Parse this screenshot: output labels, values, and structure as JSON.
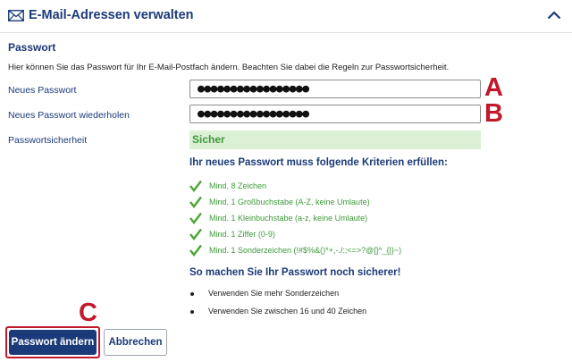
{
  "header": {
    "title": "E-Mail-Adressen verwalten",
    "mail_icon": "envelope-icon",
    "collapse_icon": "chevron-up-icon",
    "accent_color": "#1b3a7a"
  },
  "section": {
    "title": "Passwort",
    "intro": "Hier können Sie das Passwort für Ihr E-Mail-Postfach ändern. Beachten Sie dabei die Regeln zur Passwortsicherheit."
  },
  "form": {
    "new_password_label": "Neues Passwort",
    "new_password_value": "●●●●●●●●●●●●●●●●●",
    "repeat_password_label": "Neues Passwort wiederholen",
    "repeat_password_value": "●●●●●●●●●●●●●●●●●",
    "strength_label": "Passwortsicherheit",
    "strength_value": "Sicher",
    "strength_color": "#3e9a3a"
  },
  "markers": {
    "a": "A",
    "b": "B",
    "c": "C",
    "color": "#c0192c"
  },
  "criteria": {
    "heading": "Ihr neues Passwort muss folgende Kriterien erfüllen:",
    "icon": "checkmark-icon",
    "items": [
      "Mind. 8 Zeichen",
      "Mind. 1 Großbuchstabe (A-Z, keine Umlaute)",
      "Mind. 1 Kleinbuchstabe (a-z, keine Umlaute)",
      "Mind. 1 Ziffer (0-9)",
      "Mind. 1 Sonderzeichen (!#$%&()*+,-./:;<=>?@[]^_{|}~)"
    ]
  },
  "tips": {
    "heading": "So machen Sie Ihr Passwort noch sicherer!",
    "items": [
      "Verwenden Sie mehr Sonderzeichen",
      "Verwenden Sie zwischen 16 und 40 Zeichen"
    ]
  },
  "buttons": {
    "submit_label": "Passwort ändern",
    "cancel_label": "Abbrechen"
  }
}
